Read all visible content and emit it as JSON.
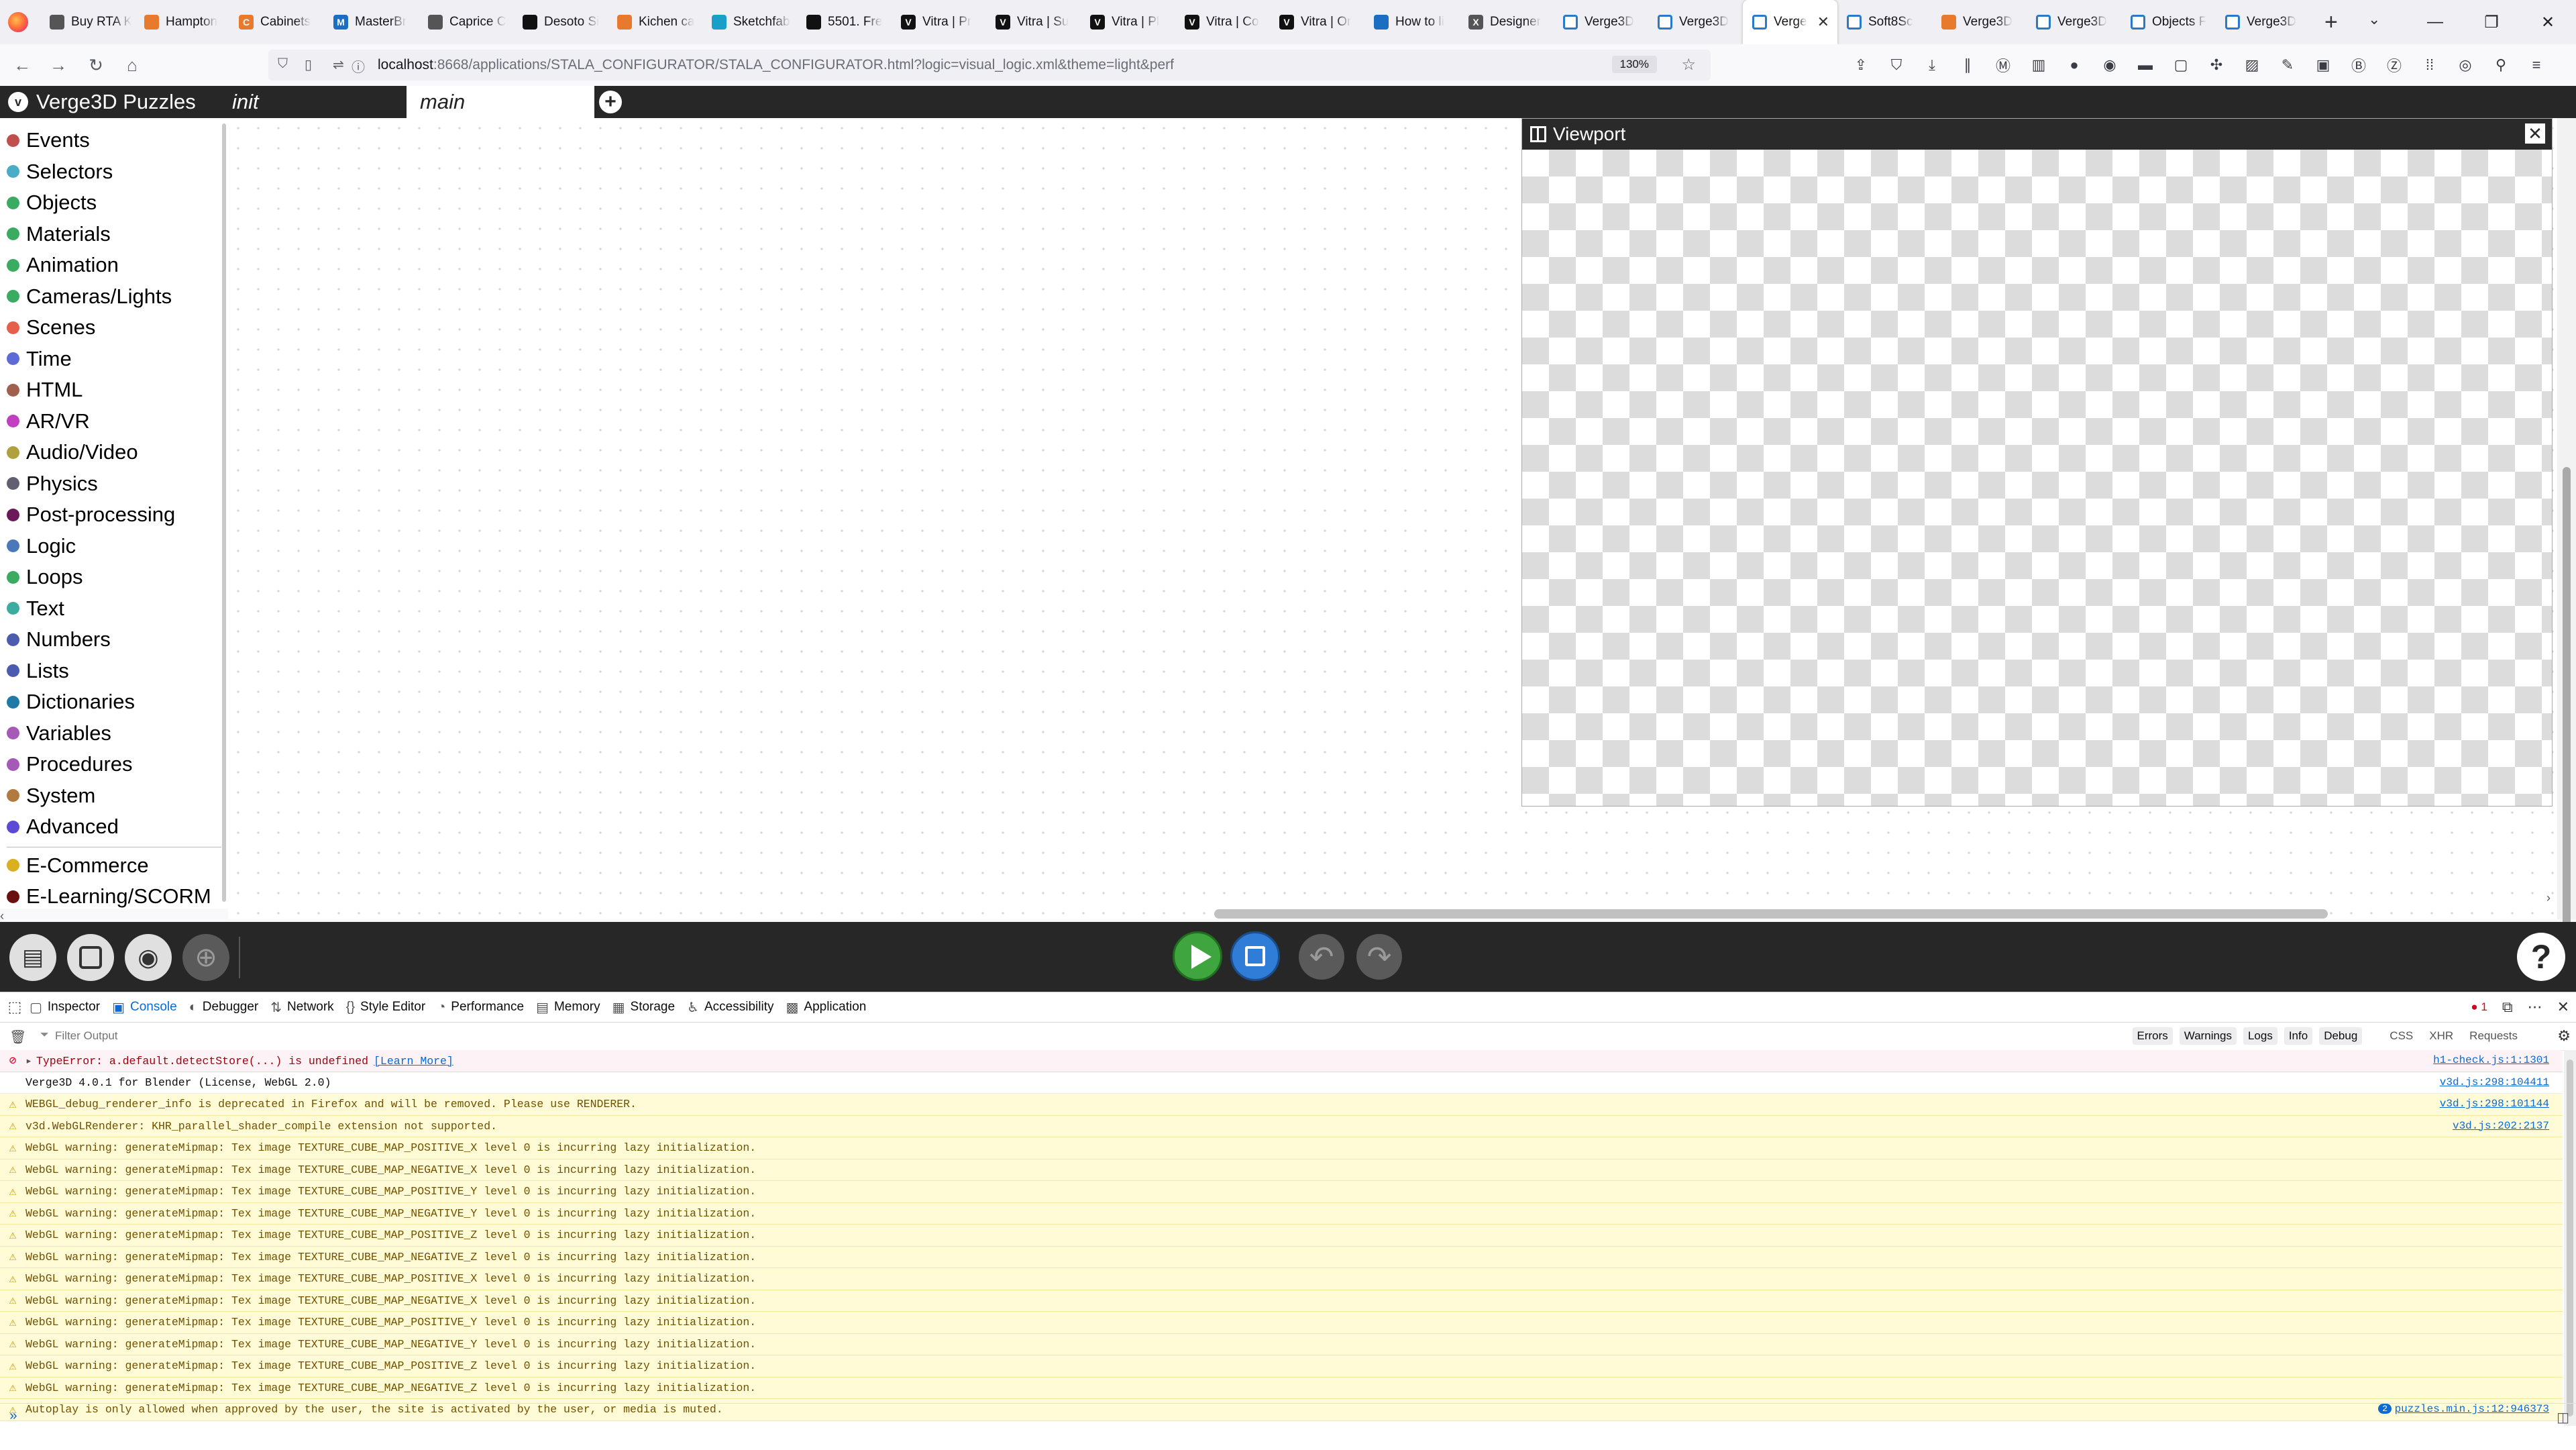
{
  "browser": {
    "tabs": [
      {
        "title": "Buy RTA K",
        "icon": "ico-gray",
        "glyph": ""
      },
      {
        "title": "Hampton",
        "icon": "ico-orange",
        "glyph": ""
      },
      {
        "title": "Cabinets",
        "icon": "ico-orange",
        "glyph": "C"
      },
      {
        "title": "MasterBr",
        "icon": "ico-blue",
        "glyph": "M"
      },
      {
        "title": "Caprice C",
        "icon": "ico-gray",
        "glyph": ""
      },
      {
        "title": "Desoto Si",
        "icon": "ico-black",
        "glyph": ""
      },
      {
        "title": "Kichen ca",
        "icon": "ico-orange",
        "glyph": ""
      },
      {
        "title": "Sketchfab",
        "icon": "ico-teal",
        "glyph": ""
      },
      {
        "title": "5501. Fre",
        "icon": "ico-black",
        "glyph": ""
      },
      {
        "title": "Vitra | Pr",
        "icon": "ico-black",
        "glyph": "V"
      },
      {
        "title": "Vitra | Su",
        "icon": "ico-black",
        "glyph": "V"
      },
      {
        "title": "Vitra | Pl",
        "icon": "ico-black",
        "glyph": "V"
      },
      {
        "title": "Vitra | Co",
        "icon": "ico-black",
        "glyph": "V"
      },
      {
        "title": "Vitra | Or",
        "icon": "ico-black",
        "glyph": "V"
      },
      {
        "title": "How to li",
        "icon": "ico-blue",
        "glyph": ""
      },
      {
        "title": "Designer",
        "icon": "ico-gray",
        "glyph": "X"
      },
      {
        "title": "Verge3D",
        "icon": "ico-v3d",
        "glyph": ""
      },
      {
        "title": "Verge3D",
        "icon": "ico-v3d",
        "glyph": ""
      },
      {
        "title": "Verge",
        "icon": "ico-v3d",
        "glyph": "",
        "active": true
      },
      {
        "title": "Soft8Sc",
        "icon": "ico-v3d",
        "glyph": ""
      },
      {
        "title": "Verge3D",
        "icon": "ico-orange",
        "glyph": ""
      },
      {
        "title": "Verge3D",
        "icon": "ico-v3d",
        "glyph": ""
      },
      {
        "title": "Objects F",
        "icon": "ico-v3d",
        "glyph": ""
      },
      {
        "title": "Verge3D",
        "icon": "ico-v3d",
        "glyph": ""
      }
    ],
    "url_host": "localhost",
    "url_rest": ":8668/applications/STALA_CONFIGURATOR/STALA_CONFIGURATOR.html?logic=visual_logic.xml&theme=light&perf",
    "zoom": "130%"
  },
  "app": {
    "title": "Verge3D Puzzles",
    "workspace_tabs": [
      "init",
      "main"
    ],
    "categories": [
      {
        "label": "Events",
        "color": "#c0504d"
      },
      {
        "label": "Selectors",
        "color": "#4bacc6"
      },
      {
        "label": "Objects",
        "color": "#3cab62"
      },
      {
        "label": "Materials",
        "color": "#3cab62"
      },
      {
        "label": "Animation",
        "color": "#3cab62"
      },
      {
        "label": "Cameras/Lights",
        "color": "#3cab62"
      },
      {
        "label": "Scenes",
        "color": "#e5604a"
      },
      {
        "label": "Time",
        "color": "#5c6bd6"
      },
      {
        "label": "HTML",
        "color": "#a0604d"
      },
      {
        "label": "AR/VR",
        "color": "#c040c0"
      },
      {
        "label": "Audio/Video",
        "color": "#b0a040"
      },
      {
        "label": "Physics",
        "color": "#606070"
      },
      {
        "label": "Post-processing",
        "color": "#6a1a5a"
      },
      {
        "label": "Logic",
        "color": "#4a78b8"
      },
      {
        "label": "Loops",
        "color": "#3cab62"
      },
      {
        "label": "Text",
        "color": "#3caba0"
      },
      {
        "label": "Numbers",
        "color": "#4a5bb0"
      },
      {
        "label": "Lists",
        "color": "#4a5bb0"
      },
      {
        "label": "Dictionaries",
        "color": "#207aa8"
      },
      {
        "label": "Variables",
        "color": "#a55ab8"
      },
      {
        "label": "Procedures",
        "color": "#a55ab8"
      },
      {
        "label": "System",
        "color": "#b07a40"
      },
      {
        "label": "Advanced",
        "color": "#5a4ad6"
      }
    ],
    "plugin_categories": [
      {
        "label": "E-Commerce",
        "color": "#d8b020"
      },
      {
        "label": "E-Learning/SCORM",
        "color": "#6a1010"
      }
    ],
    "viewport_title": "Viewport"
  },
  "devtools": {
    "tabs": [
      {
        "label": "Inspector",
        "icon": "▢"
      },
      {
        "label": "Console",
        "icon": "▣",
        "active": true
      },
      {
        "label": "Debugger",
        "icon": "◐"
      },
      {
        "label": "Network",
        "icon": "⇅"
      },
      {
        "label": "Style Editor",
        "icon": "{}"
      },
      {
        "label": "Performance",
        "icon": "◔"
      },
      {
        "label": "Memory",
        "icon": "▤"
      },
      {
        "label": "Storage",
        "icon": "▦"
      },
      {
        "label": "Accessibility",
        "icon": "♿"
      },
      {
        "label": "Application",
        "icon": "▩"
      }
    ],
    "error_count": "1",
    "filter_placeholder": "Filter Output",
    "levels": [
      "Errors",
      "Warnings",
      "Logs",
      "Info",
      "Debug"
    ],
    "extra_filters": [
      "CSS",
      "XHR",
      "Requests"
    ],
    "messages": [
      {
        "type": "error",
        "text": "TypeError: a.default.detectStore(...) is undefined",
        "link": "[Learn More]",
        "src": "h1-check.js:1:1301"
      },
      {
        "type": "log",
        "text": "Verge3D 4.0.1 for Blender (License, WebGL 2.0)",
        "src": "v3d.js:298:104411"
      },
      {
        "type": "warn",
        "text": "WEBGL_debug_renderer_info is deprecated in Firefox and will be removed. Please use RENDERER.",
        "src": "v3d.js:298:101144"
      },
      {
        "type": "warn",
        "text": "v3d.WebGLRenderer: KHR_parallel_shader_compile extension not supported.",
        "src": "v3d.js:202:2137"
      },
      {
        "type": "warn",
        "text": "WebGL warning: generateMipmap: Tex image TEXTURE_CUBE_MAP_POSITIVE_X level 0 is incurring lazy initialization."
      },
      {
        "type": "warn",
        "text": "WebGL warning: generateMipmap: Tex image TEXTURE_CUBE_MAP_NEGATIVE_X level 0 is incurring lazy initialization."
      },
      {
        "type": "warn",
        "text": "WebGL warning: generateMipmap: Tex image TEXTURE_CUBE_MAP_POSITIVE_Y level 0 is incurring lazy initialization."
      },
      {
        "type": "warn",
        "text": "WebGL warning: generateMipmap: Tex image TEXTURE_CUBE_MAP_NEGATIVE_Y level 0 is incurring lazy initialization."
      },
      {
        "type": "warn",
        "text": "WebGL warning: generateMipmap: Tex image TEXTURE_CUBE_MAP_POSITIVE_Z level 0 is incurring lazy initialization."
      },
      {
        "type": "warn",
        "text": "WebGL warning: generateMipmap: Tex image TEXTURE_CUBE_MAP_NEGATIVE_Z level 0 is incurring lazy initialization."
      },
      {
        "type": "warn",
        "text": "WebGL warning: generateMipmap: Tex image TEXTURE_CUBE_MAP_POSITIVE_X level 0 is incurring lazy initialization."
      },
      {
        "type": "warn",
        "text": "WebGL warning: generateMipmap: Tex image TEXTURE_CUBE_MAP_NEGATIVE_X level 0 is incurring lazy initialization."
      },
      {
        "type": "warn",
        "text": "WebGL warning: generateMipmap: Tex image TEXTURE_CUBE_MAP_POSITIVE_Y level 0 is incurring lazy initialization."
      },
      {
        "type": "warn",
        "text": "WebGL warning: generateMipmap: Tex image TEXTURE_CUBE_MAP_NEGATIVE_Y level 0 is incurring lazy initialization."
      },
      {
        "type": "warn",
        "text": "WebGL warning: generateMipmap: Tex image TEXTURE_CUBE_MAP_POSITIVE_Z level 0 is incurring lazy initialization."
      },
      {
        "type": "warn",
        "text": "WebGL warning: generateMipmap: Tex image TEXTURE_CUBE_MAP_NEGATIVE_Z level 0 is incurring lazy initialization."
      },
      {
        "type": "warn",
        "text": "Autoplay is only allowed when approved by the user, the site is activated by the user, or media is muted.",
        "src": "puzzles.min.js:12:946373",
        "badge": "2"
      }
    ],
    "prompt": "»"
  }
}
